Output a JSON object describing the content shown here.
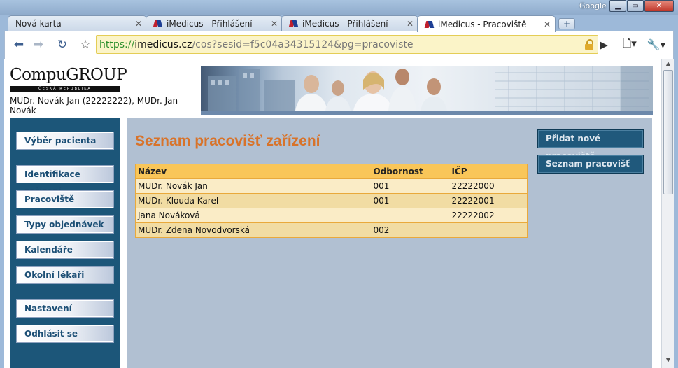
{
  "window": {
    "brand_label": "Google",
    "minimize": "▁",
    "maximize": "▭",
    "close": "✕"
  },
  "tabs": [
    {
      "title": "Nová karta",
      "close": "✕"
    },
    {
      "title": "iMedicus - Přihlášení",
      "close": "✕"
    },
    {
      "title": "iMedicus - Přihlášení",
      "close": "✕"
    },
    {
      "title": "iMedicus - Pracoviště",
      "close": "✕"
    }
  ],
  "toolbar": {
    "url_scheme": "https://",
    "url_host": "imedicus.cz",
    "url_rest": "/cos?sesid=f5c04a34315124&pg=pracoviste"
  },
  "page": {
    "logo_text": "CompuGROUP",
    "logo_sub": "ČESKÁ REPUBLIKA",
    "user_line": "MUDr. Novák Jan (22222222), MUDr. Jan Novák",
    "title": "Seznam pracovišť zařízení"
  },
  "sidebar": {
    "items": [
      {
        "label": "Výběr pacienta"
      },
      {
        "label": "Identifikace zařízení"
      },
      {
        "label": "Pracoviště"
      },
      {
        "label": "Typy objednávek"
      },
      {
        "label": "Kalendáře"
      },
      {
        "label": "Okolní lékaři"
      },
      {
        "label": "Nastavení"
      },
      {
        "label": "Odhlásit se"
      }
    ]
  },
  "actions": {
    "add_label": "Přidat nové pracoviště",
    "list_label": "Seznam pracovišť"
  },
  "table": {
    "headers": [
      "Název",
      "Odbornost",
      "IČP"
    ],
    "rows": [
      [
        "MUDr. Novák Jan",
        "001",
        "22222000"
      ],
      [
        "MUDr. Klouda Karel",
        "001",
        "22222001"
      ],
      [
        "Jana Nováková",
        "",
        "22222002"
      ],
      [
        "MUDr. Zdena Novodvorská",
        "002",
        ""
      ]
    ]
  }
}
